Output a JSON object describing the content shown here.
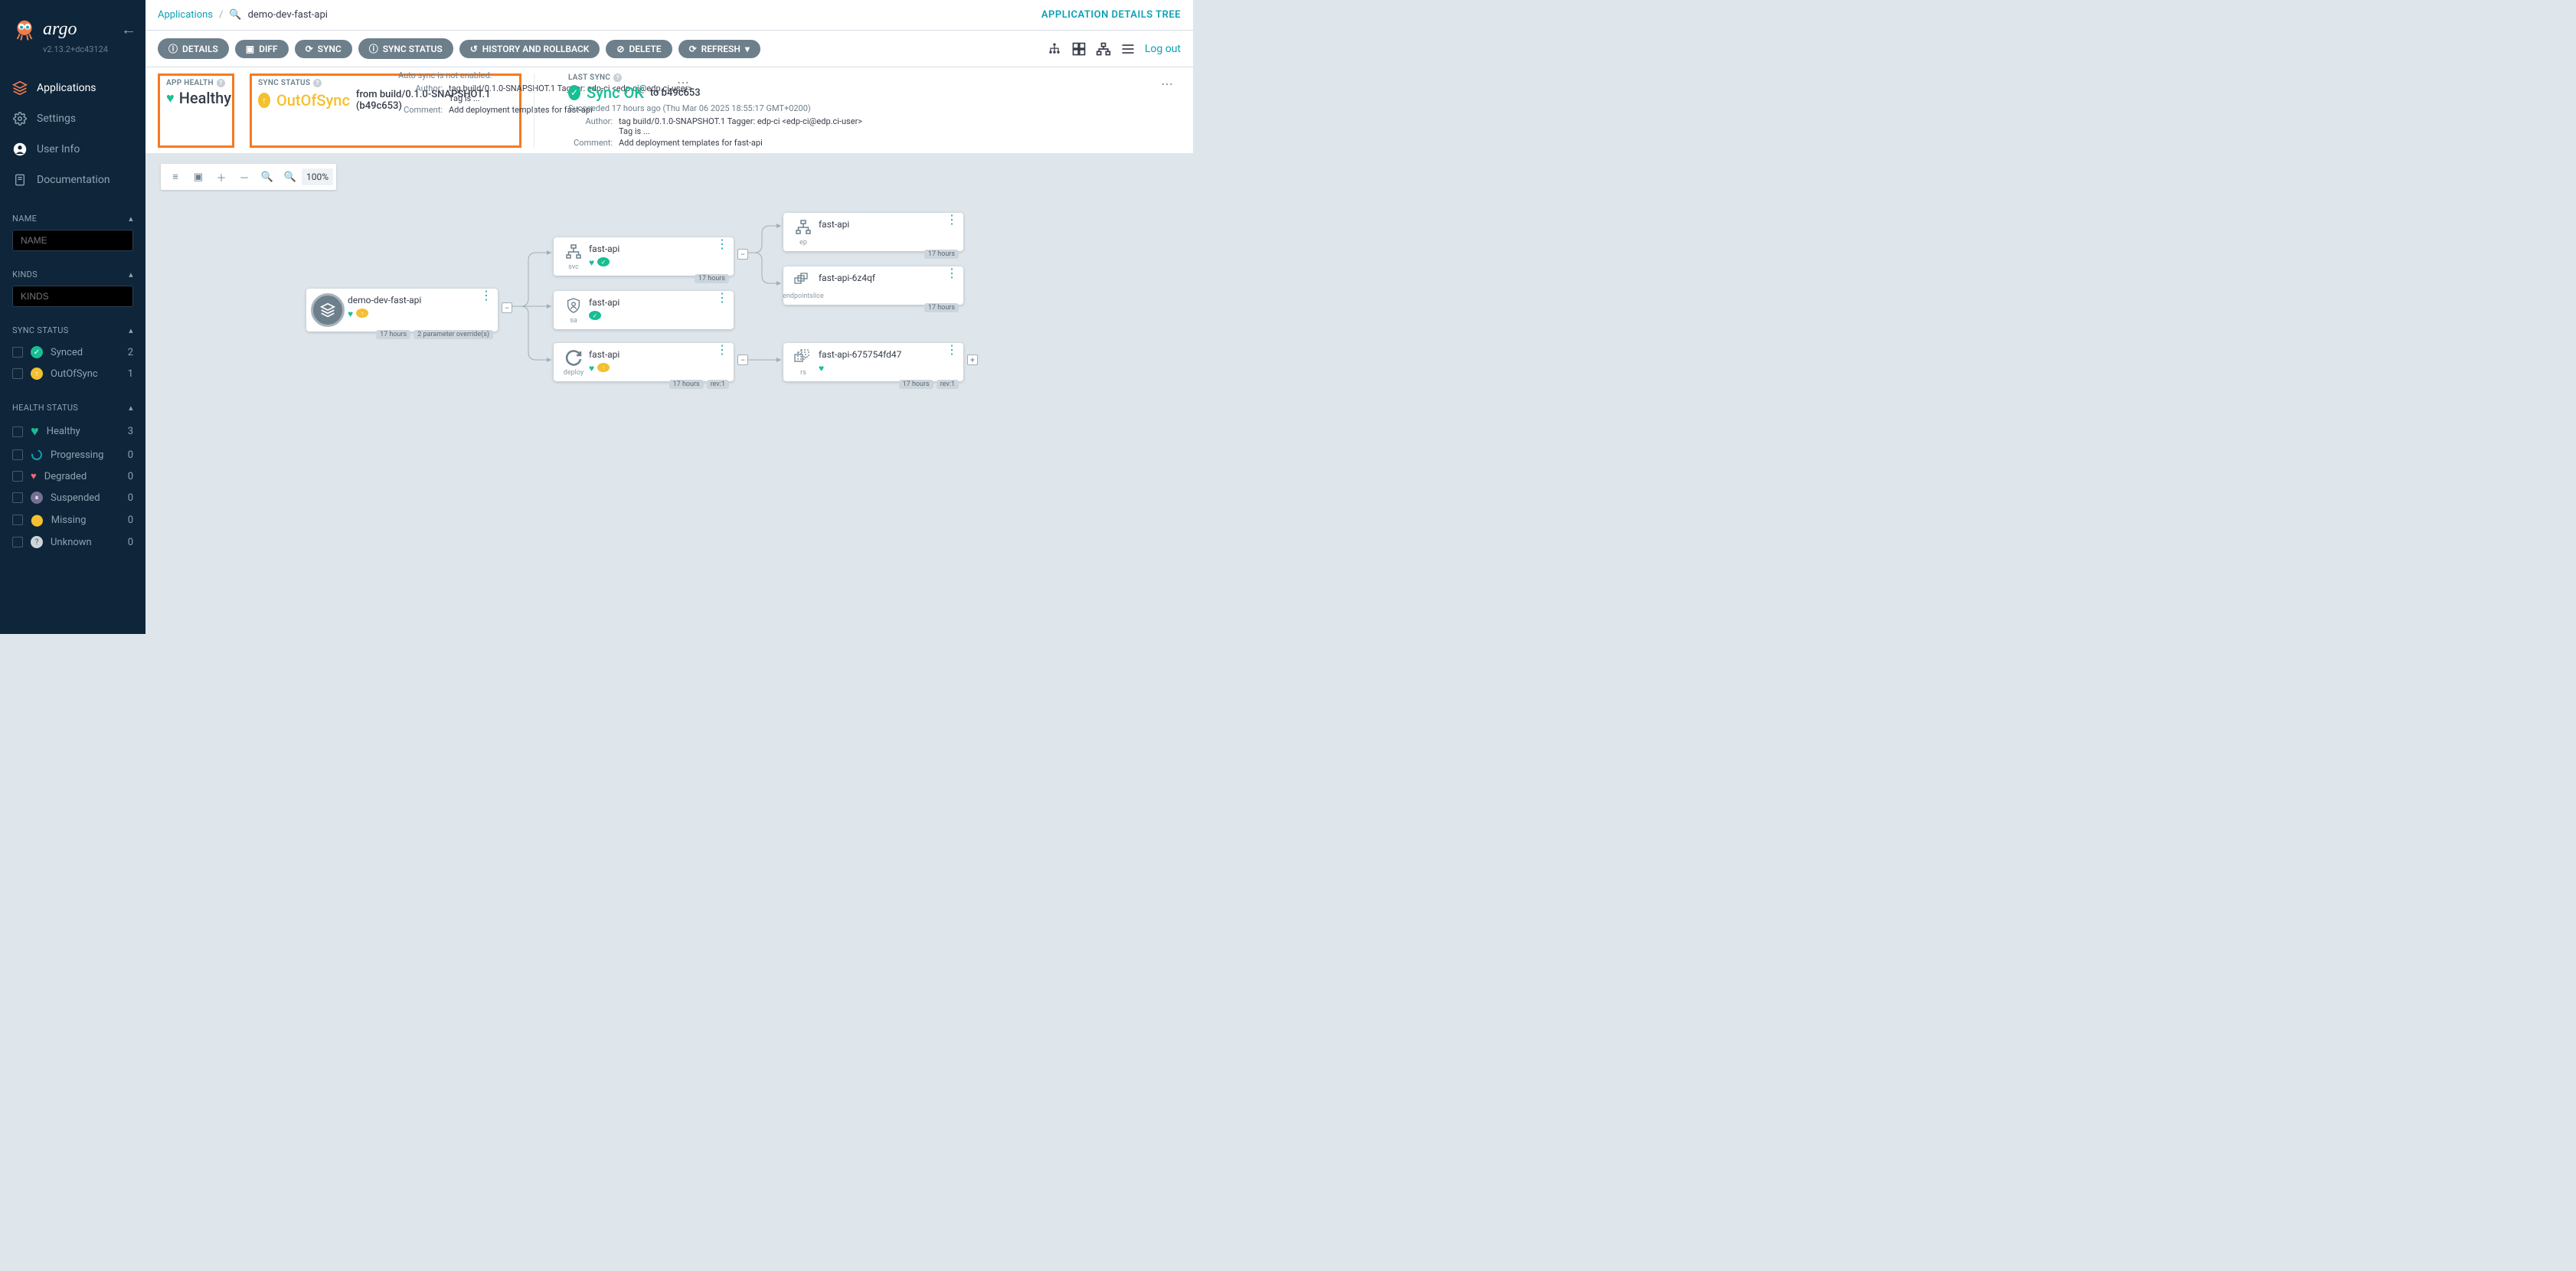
{
  "brand": "argo",
  "version": "v2.13.2+dc43124",
  "nav": {
    "applications": "Applications",
    "settings": "Settings",
    "userinfo": "User Info",
    "documentation": "Documentation"
  },
  "filters": {
    "name_label": "NAME",
    "name_placeholder": "NAME",
    "kinds_label": "KINDS",
    "kinds_placeholder": "KINDS",
    "sync_label": "SYNC STATUS",
    "synced_label": "Synced",
    "synced_count": "2",
    "outofsync_label": "OutOfSync",
    "outofsync_count": "1",
    "health_label": "HEALTH STATUS",
    "healthy_label": "Healthy",
    "healthy_count": "3",
    "progressing_label": "Progressing",
    "progressing_count": "0",
    "degraded_label": "Degraded",
    "degraded_count": "0",
    "suspended_label": "Suspended",
    "suspended_count": "0",
    "missing_label": "Missing",
    "missing_count": "0",
    "unknown_label": "Unknown",
    "unknown_count": "0"
  },
  "breadcrumb": {
    "applications": "Applications",
    "app": "demo-dev-fast-api"
  },
  "tree_link": "APPLICATION DETAILS TREE",
  "actions": {
    "details": "DETAILS",
    "diff": "DIFF",
    "sync": "SYNC",
    "sync_status": "SYNC STATUS",
    "history": "HISTORY AND ROLLBACK",
    "delete": "DELETE",
    "refresh": "REFRESH"
  },
  "logout": "Log out",
  "app_health": {
    "label": "APP HEALTH",
    "status": "Healthy"
  },
  "sync_status": {
    "label": "SYNC STATUS",
    "status": "OutOfSync",
    "from": "from build/0.1.0-SNAPSHOT.1 (b49c653)",
    "auto_sync": "Auto sync is not enabled.",
    "author_k": "Author:",
    "author_v": "tag build/0.1.0-SNAPSHOT.1 Tagger: edp-ci <edp-ci@edp.ci-user> Tag is ...",
    "comment_k": "Comment:",
    "comment_v": "Add deployment templates for fast-api"
  },
  "last_sync": {
    "label": "LAST SYNC",
    "status": "Sync OK",
    "to": "to b49c653",
    "result": "Succeeded 17 hours ago (Thu Mar 06 2025 18:55:17 GMT+0200)",
    "author_k": "Author:",
    "author_v": "tag build/0.1.0-SNAPSHOT.1 Tagger: edp-ci <edp-ci@edp.ci-user> Tag is ...",
    "comment_k": "Comment:",
    "comment_v": "Add deployment templates for fast-api"
  },
  "zoom": "100%",
  "nodes": {
    "root": {
      "name": "demo-dev-fast-api",
      "age": "17 hours",
      "override": "2 parameter override(s)"
    },
    "svc": {
      "name": "fast-api",
      "kind": "svc",
      "age": "17 hours"
    },
    "sa": {
      "name": "fast-api",
      "kind": "sa"
    },
    "deploy": {
      "name": "fast-api",
      "kind": "deploy",
      "age": "17 hours",
      "rev": "rev:1"
    },
    "ep": {
      "name": "fast-api",
      "kind": "ep",
      "age": "17 hours"
    },
    "slice": {
      "name": "fast-api-6z4qf",
      "kind": "endpointslice",
      "age": "17 hours"
    },
    "rs": {
      "name": "fast-api-675754fd47",
      "kind": "rs",
      "age": "17 hours",
      "rev": "rev:1"
    }
  }
}
